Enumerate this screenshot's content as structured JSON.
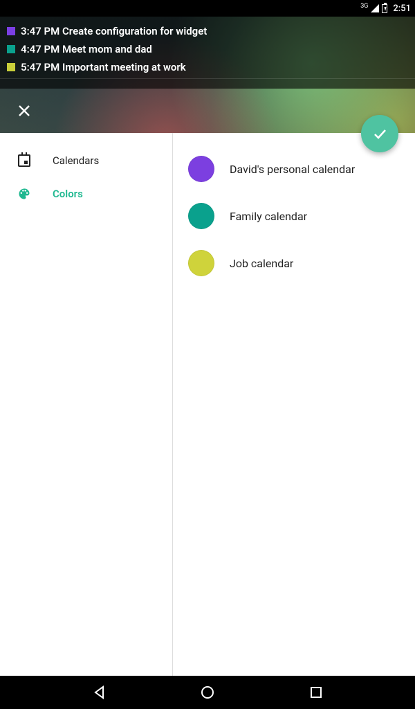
{
  "status": {
    "network": "3G",
    "time": "2:51"
  },
  "notifications": [
    {
      "color": "#7b3fe4",
      "text": "3:47 PM Create configuration for widget"
    },
    {
      "color": "#0aa18d",
      "text": "4:47 PM Meet mom and dad"
    },
    {
      "color": "#c9cf3a",
      "text": "5:47 PM Important meeting at work"
    }
  ],
  "sidebar": {
    "items": [
      {
        "label": "Calendars",
        "active": false
      },
      {
        "label": "Colors",
        "active": true
      }
    ]
  },
  "calendars": [
    {
      "color": "#7c3fe0",
      "label": "David's personal calendar"
    },
    {
      "color": "#0aa18d",
      "label": "Family calendar"
    },
    {
      "color": "#cfd33b",
      "label": "Job calendar"
    }
  ]
}
